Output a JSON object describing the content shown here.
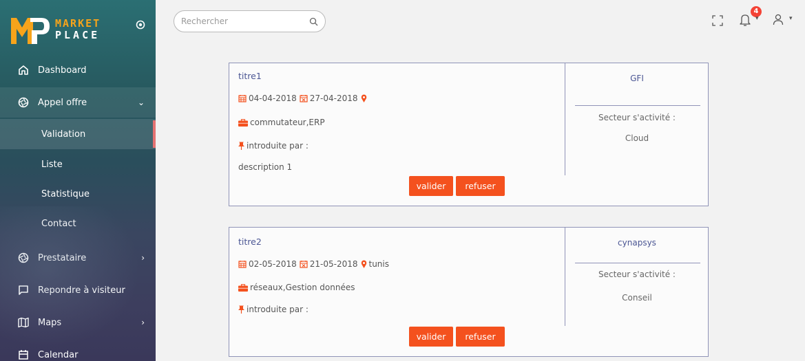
{
  "brand": {
    "line1": "MARKET",
    "line2": "PLACE"
  },
  "sidebar": {
    "items": [
      {
        "label": "Dashboard",
        "icon": "home-icon"
      },
      {
        "label": "Appel offre",
        "icon": "aperture-icon",
        "chevron": "⌄",
        "expanded": true
      },
      {
        "label": "Prestataire",
        "icon": "aperture-icon",
        "chevron": "›"
      },
      {
        "label": "Repondre à visiteur",
        "icon": "message-square-icon"
      },
      {
        "label": "Maps",
        "icon": "map-icon",
        "chevron": "›"
      },
      {
        "label": "Calendar",
        "icon": "calendar-icon"
      }
    ],
    "subitems": [
      {
        "label": "Validation",
        "active": true
      },
      {
        "label": "Liste"
      },
      {
        "label": "Statistique"
      },
      {
        "label": "Contact"
      }
    ]
  },
  "search": {
    "placeholder": "Rechercher"
  },
  "topbar": {
    "notification_count": "4"
  },
  "colors": {
    "accent": "#f4511e",
    "title": "#4a5593",
    "active_marker": "#e57373",
    "badge": "#f44336"
  },
  "offers": [
    {
      "title": "titre1",
      "start_date": "04-04-2018",
      "end_date": "27-04-2018",
      "location": "",
      "tags": "commutateur,ERP",
      "introduced_by": "introduite par :",
      "description": "description 1",
      "company": "GFI",
      "sector_label": "Secteur s'activité :",
      "sector": "Cloud",
      "validate_label": "valider",
      "refuse_label": "refuser"
    },
    {
      "title": "titre2",
      "start_date": "02-05-2018",
      "end_date": "21-05-2018",
      "location": "tunis",
      "tags": "réseaux,Gestion données",
      "introduced_by": "introduite par :",
      "description": "",
      "company": "cynapsys",
      "sector_label": "Secteur s'activité :",
      "sector": "Conseil",
      "validate_label": "valider",
      "refuse_label": "refuser"
    }
  ]
}
